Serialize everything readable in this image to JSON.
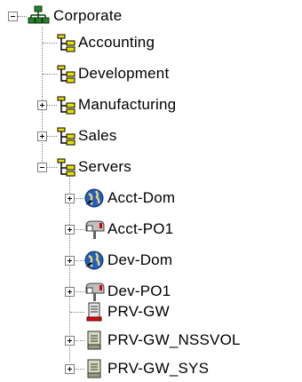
{
  "tree": {
    "root": {
      "label": "Corporate",
      "icon": "organization-icon"
    },
    "items": [
      {
        "label": "Accounting",
        "icon": "org-unit-icon"
      },
      {
        "label": "Development",
        "icon": "org-unit-icon"
      },
      {
        "label": "Manufacturing",
        "icon": "org-unit-icon"
      },
      {
        "label": "Sales",
        "icon": "org-unit-icon"
      },
      {
        "label": "Servers",
        "icon": "org-unit-icon"
      },
      {
        "label": "Acct-Dom",
        "icon": "domain-globe-icon"
      },
      {
        "label": "Acct-PO1",
        "icon": "post-office-icon"
      },
      {
        "label": "Dev-Dom",
        "icon": "domain-globe-icon"
      },
      {
        "label": "Dev-PO1",
        "icon": "post-office-icon"
      },
      {
        "label": "PRV-GW",
        "icon": "gateway-icon"
      },
      {
        "label": "PRV-GW_NSSVOL",
        "icon": "volume-icon"
      },
      {
        "label": "PRV-GW_SYS",
        "icon": "volume-icon"
      }
    ]
  }
}
